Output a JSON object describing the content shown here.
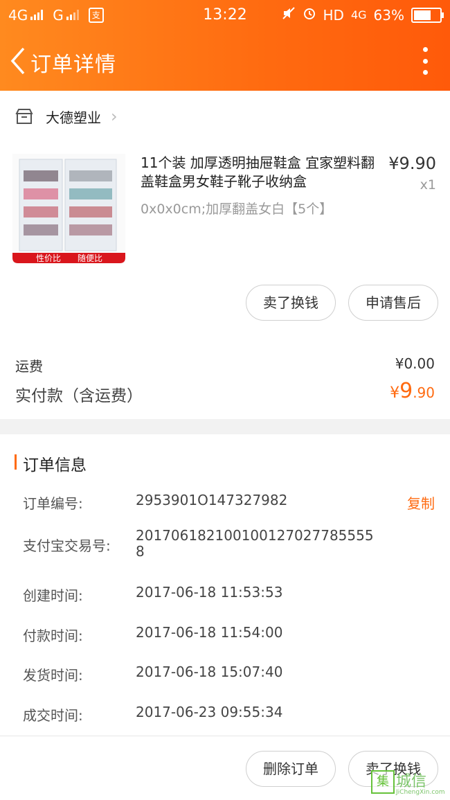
{
  "status_bar": {
    "network1": "4G",
    "network2": "G",
    "pay_app_icon": "alipay-app-icon",
    "time": "13:22",
    "hd_label": "HD",
    "network3": "4G",
    "battery_percent": "63%",
    "battery_level": 0.63
  },
  "header": {
    "title": "订单详情",
    "accent_color": "#ff6a10"
  },
  "shop": {
    "name": "大德塑业"
  },
  "product": {
    "title": "11个装 加厚透明抽屉鞋盒 宜家塑料翻盖鞋盒男女鞋子靴子收纳盒",
    "spec": "0x0x0cm;加厚翻盖女白【5个】",
    "price": "¥9.90",
    "quantity": "x1",
    "image_tags": [
      "性价比",
      "随便比"
    ]
  },
  "actions": {
    "sell_label": "卖了换钱",
    "after_sale_label": "申请售后"
  },
  "payment": {
    "shipping_label": "运费",
    "shipping_value": "¥0.00",
    "paid_label": "实付款（含运费）",
    "paid_currency": "¥",
    "paid_integer": "9",
    "paid_decimal": ".90"
  },
  "order_info": {
    "section_title": "订单信息",
    "copy_label": "复制",
    "rows": [
      {
        "label": "订单编号:",
        "value": "2953901O147327982"
      },
      {
        "label": "支付宝交易号:",
        "value": "201706182100100127027785555 8"
      },
      {
        "label": "创建时间:",
        "value": "2017-06-18 11:53:53"
      },
      {
        "label": "付款时间:",
        "value": "2017-06-18 11:54:00"
      },
      {
        "label": "发货时间:",
        "value": "2017-06-18 15:07:40"
      },
      {
        "label": "成交时间:",
        "value": "2017-06-23 09:55:34"
      }
    ]
  },
  "footer": {
    "delete_label": "删除订单",
    "sell_label": "卖了换钱"
  },
  "watermark": {
    "logo_char": "集",
    "text": "城信",
    "url": "JiChengXin.com"
  }
}
